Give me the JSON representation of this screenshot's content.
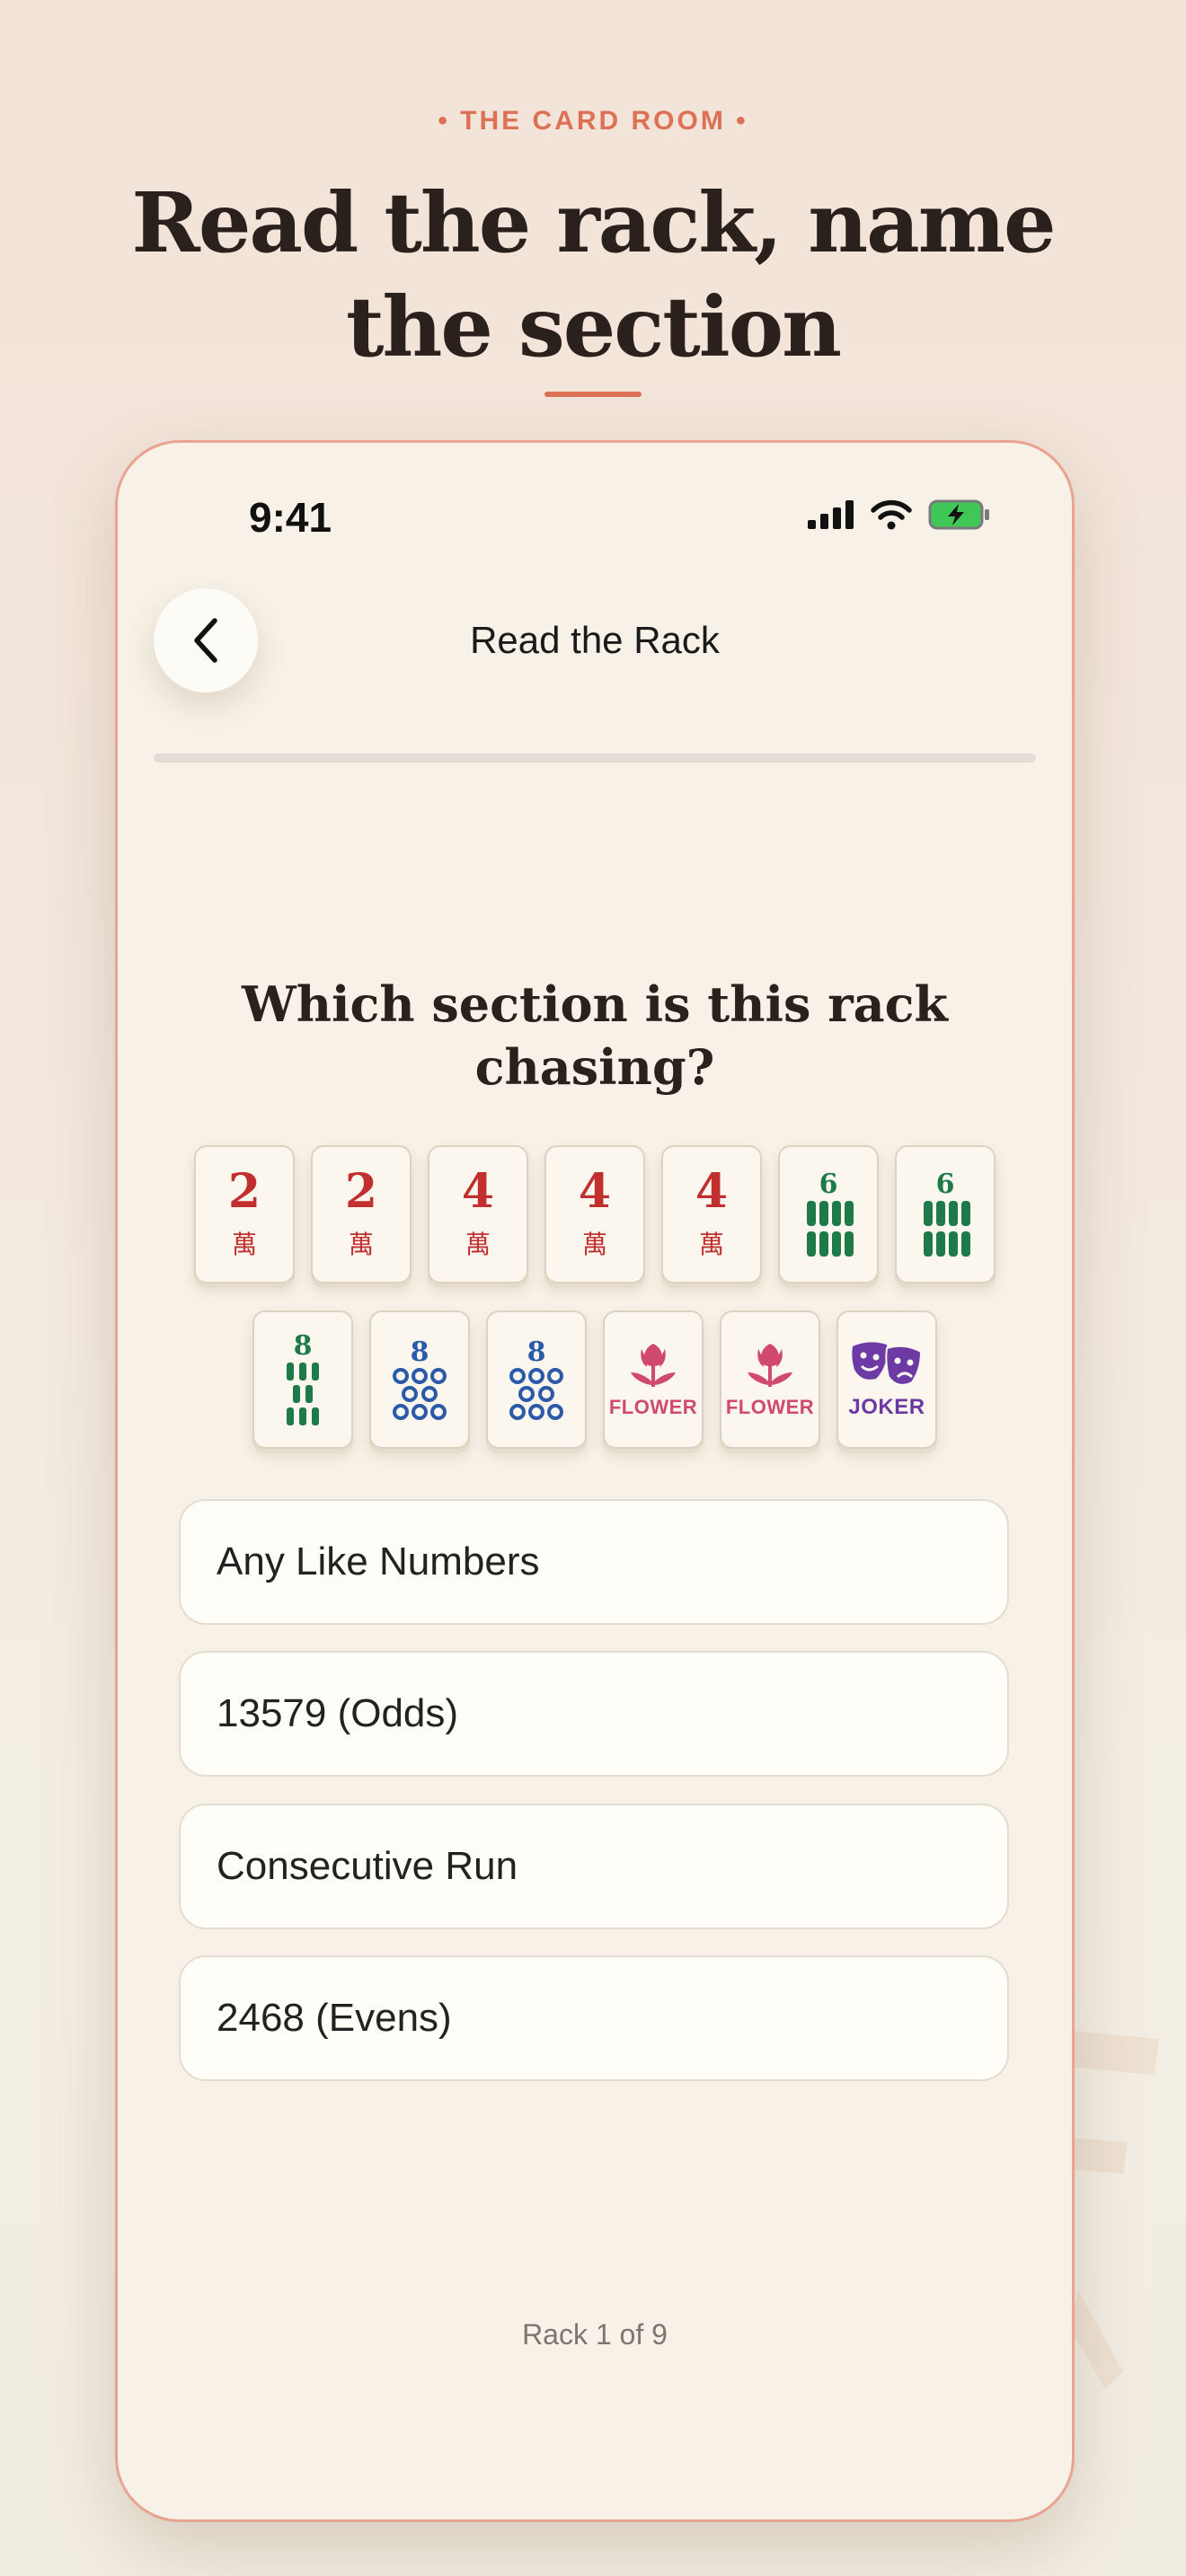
{
  "header": {
    "kicker": "• THE CARD ROOM •",
    "headline": "Read the rack, name the section"
  },
  "status_bar": {
    "time": "9:41"
  },
  "nav": {
    "title": "Read the Rack"
  },
  "progress": {
    "fraction": 0.0
  },
  "question": "Which section is this rack chasing?",
  "tiles": [
    {
      "suit": "crak",
      "value": "2",
      "char": "萬"
    },
    {
      "suit": "crak",
      "value": "2",
      "char": "萬"
    },
    {
      "suit": "crak",
      "value": "4",
      "char": "萬"
    },
    {
      "suit": "crak",
      "value": "4",
      "char": "萬"
    },
    {
      "suit": "crak",
      "value": "4",
      "char": "萬"
    },
    {
      "suit": "bam",
      "value": "6"
    },
    {
      "suit": "bam",
      "value": "6"
    },
    {
      "suit": "bam",
      "value": "8"
    },
    {
      "suit": "dot",
      "value": "8"
    },
    {
      "suit": "dot",
      "value": "8"
    },
    {
      "suit": "flower",
      "label": "FLOWER"
    },
    {
      "suit": "flower",
      "label": "FLOWER"
    },
    {
      "suit": "joker",
      "label": "JOKER"
    }
  ],
  "answers": [
    "Any Like Numbers",
    "13579 (Odds)",
    "Consecutive Run",
    "2468 (Evens)"
  ],
  "footer": {
    "count": "Rack 1 of 9"
  },
  "colors": {
    "accent": "#dd7156",
    "crak": "#c22f2f",
    "bam": "#1f7a4a",
    "dot": "#2b5ba8",
    "flower": "#cf4a6c",
    "joker": "#6d3aa5"
  }
}
